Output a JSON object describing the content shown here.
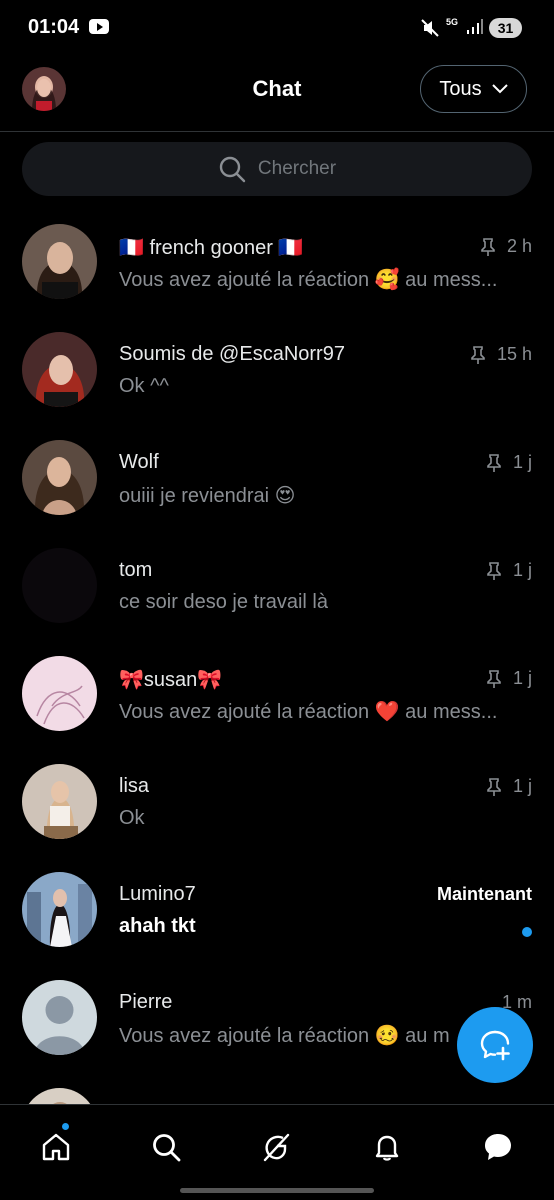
{
  "status_bar": {
    "time": "01:04",
    "network": "5G",
    "battery": "31"
  },
  "header": {
    "title": "Chat",
    "filter_label": "Tous"
  },
  "search": {
    "placeholder": "Chercher"
  },
  "chats": [
    {
      "name": "🇫🇷 french gooner 🇫🇷",
      "preview": "Vous avez ajouté la réaction 🥰 au mess...",
      "time": "2 h",
      "pinned": true
    },
    {
      "name": "Soumis de @EscaNorr97",
      "preview": "Ok ^^",
      "time": "15 h",
      "pinned": true
    },
    {
      "name": "Wolf",
      "preview": "ouiii je reviendrai 😍",
      "time": "1 j",
      "pinned": true
    },
    {
      "name": "tom",
      "preview": "ce soir deso je travail là",
      "time": "1 j",
      "pinned": true
    },
    {
      "name": "🎀susan🎀",
      "preview": "Vous avez ajouté la réaction ❤️ au mess...",
      "time": "1 j",
      "pinned": true
    },
    {
      "name": "lisa",
      "preview": "Ok",
      "time": "1 j",
      "pinned": true
    },
    {
      "name": "Lumino7",
      "preview": "ahah tkt",
      "time": "Maintenant",
      "pinned": false,
      "unread": true
    },
    {
      "name": "Pierre",
      "preview": "Vous avez ajouté la réaction 🥴 au m",
      "time": "1 m",
      "pinned": false
    }
  ],
  "colors": {
    "accent": "#1d9bf0",
    "background": "#000000",
    "secondary_text": "#8b8f94"
  },
  "icons": {
    "nav": [
      "home-icon",
      "search-icon",
      "grok-icon",
      "bell-icon",
      "chat-icon"
    ],
    "fab": "new-message-icon"
  }
}
